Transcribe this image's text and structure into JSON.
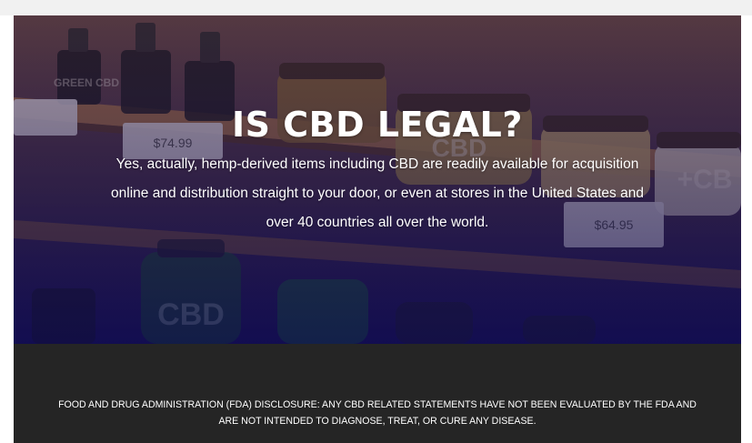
{
  "hero": {
    "title": "IS CBD LEGAL?",
    "body": "Yes, actually, hemp-derived items including CBD are readily available for acquisition online and distribution straight to your door, or even at stores in the United States and over 40 countries all over the world.",
    "price_tags": [
      "$74.99",
      "$64.95"
    ],
    "product_labels": [
      "CBD",
      "+CB",
      "GREEN CBD",
      "CBD"
    ]
  },
  "disclosure": {
    "text": "FOOD AND DRUG ADMINISTRATION (FDA) DISCLOSURE: ANY CBD RELATED STATEMENTS HAVE NOT BEEN EVALUATED BY THE FDA AND ARE NOT INTENDED TO DIAGNOSE, TREAT, OR CURE ANY DISEASE."
  },
  "colors": {
    "hero_overlay": "#1d1550",
    "footer_bg": "#252525",
    "text": "#ffffff"
  }
}
